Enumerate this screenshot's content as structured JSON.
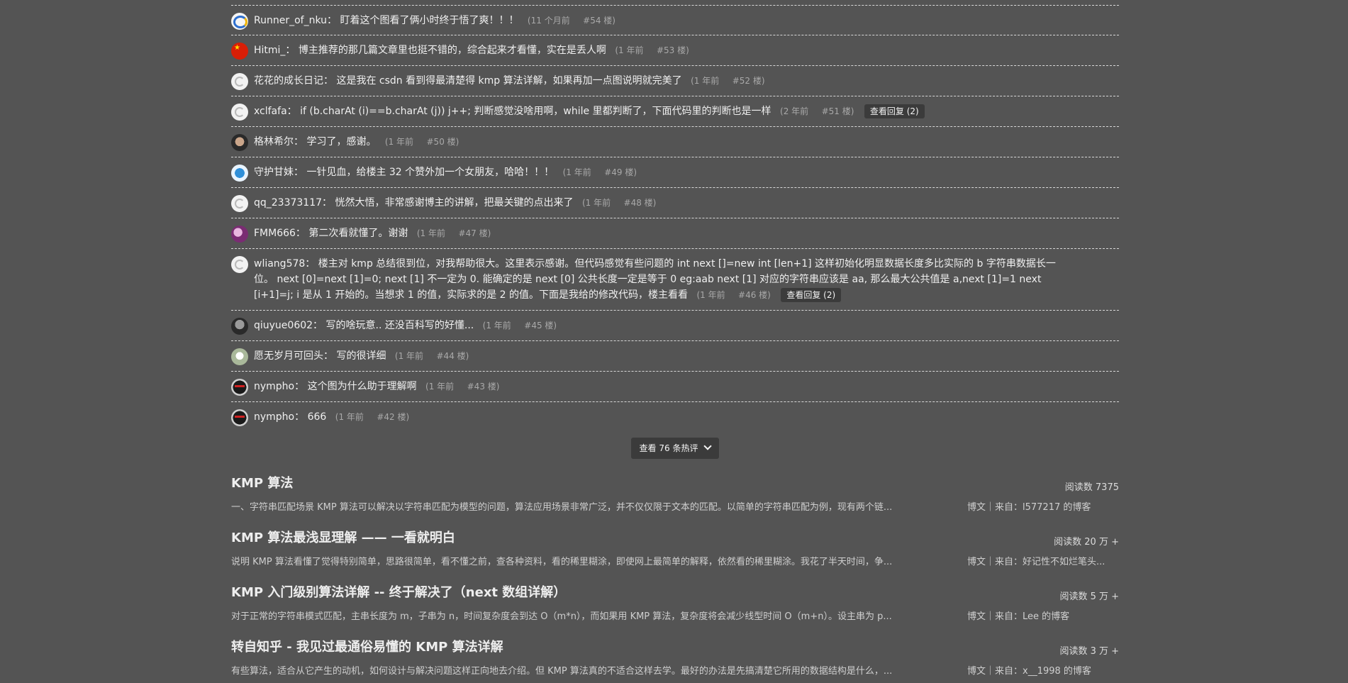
{
  "comments": [
    {
      "user": "Runner_of_nku：",
      "text": "盯着这个图看了俩小时终于悟了爽！！！",
      "time": "(11 个月前",
      "floor": "#54 楼)",
      "avatar": "kfc-icon",
      "reply": ""
    },
    {
      "user": "Hitmi_：",
      "text": "博主推荐的那几篇文章里也挺不错的，综合起来才看懂，实在是丢人啊",
      "time": "(1 年前",
      "floor": "#53 楼)",
      "avatar": "flag-icon",
      "reply": ""
    },
    {
      "user": "花花的成长日记：",
      "text": "这是我在 csdn 看到得最清楚得 kmp 算法详解，如果再加一点图说明就完美了",
      "time": "(1 年前",
      "floor": "#52 楼)",
      "avatar": "csdn-icon",
      "reply": ""
    },
    {
      "user": "xclfafa：",
      "text": "if (b.charAt (i)==b.charAt (j)) j++; 判断感觉没啥用啊，while 里都判断了，下面代码里的判断也是一样",
      "time": "(2 年前",
      "floor": "#51 楼)",
      "avatar": "csdn-icon",
      "reply": "查看回复 (2)"
    },
    {
      "user": "格林希尔：",
      "text": "学习了，感谢。",
      "time": "(1 年前",
      "floor": "#50 楼)",
      "avatar": "dark-icon",
      "reply": ""
    },
    {
      "user": "守护甘妹：",
      "text": "一针见血，给楼主 32 个赞外加一个女朋友，哈哈！！！",
      "time": "(1 年前",
      "floor": "#49 楼)",
      "avatar": "blue-icon",
      "reply": ""
    },
    {
      "user": "qq_23373117：",
      "text": "恍然大悟，非常感谢博主的讲解，把最关键的点出来了",
      "time": "(1 年前",
      "floor": "#48 楼)",
      "avatar": "csdn-icon",
      "reply": ""
    },
    {
      "user": "FMM666：",
      "text": "第二次看就懂了。谢谢",
      "time": "(1 年前",
      "floor": "#47 楼)",
      "avatar": "pink-icon",
      "reply": ""
    },
    {
      "user": "wliang578：",
      "text": "楼主对 kmp 总结很到位，对我帮助很大。这里表示感谢。但代码感觉有些问题的 int next []=new int [len+1] 这样初始化明显数据长度多比实际的 b 字符串数据长一位。 next [0]=next [1]=0; next [1] 不一定为 0. 能确定的是 next [0] 公共长度一定是等于 0 eg:aab next [1] 对应的字符串应该是 aa, 那么最大公共值是 a,next [1]=1 next [i+1]=j; i 是从 1 开始的。当想求 1 的值，实际求的是 2 的值。下面是我给的修改代码，楼主看看",
      "time": "(1 年前",
      "floor": "#46 楼)",
      "avatar": "csdn-icon",
      "reply": "查看回复 (2)"
    },
    {
      "user": "qiuyue0602：",
      "text": "写的啥玩意.. 还没百科写的好懂...",
      "time": "(1 年前",
      "floor": "#45 楼)",
      "avatar": "grey-icon",
      "reply": ""
    },
    {
      "user": "愿无岁月可回头：",
      "text": "写的很详细",
      "time": "(1 年前",
      "floor": "#44 楼)",
      "avatar": "light-icon",
      "reply": ""
    },
    {
      "user": "nympho：",
      "text": "这个图为什么助于理解啊",
      "time": "(1 年前",
      "floor": "#43 楼)",
      "avatar": "mask-icon",
      "reply": ""
    },
    {
      "user": "nympho：",
      "text": "666",
      "time": "(1 年前",
      "floor": "#42 楼)",
      "avatar": "mask-icon",
      "reply": ""
    }
  ],
  "more_button": {
    "label": "查看 76 条热评"
  },
  "related": [
    {
      "title": "KMP 算法",
      "reads": "阅读数 7375",
      "desc": "一、字符串匹配场景 KMP 算法可以解决以字符串匹配为模型的问题，算法应用场景非常广泛，并不仅仅限于文本的匹配。以简单的字符串匹配为例，现有两个链...",
      "source": "博文｜来自：l577217 的博客"
    },
    {
      "title": "KMP 算法最浅显理解 —— 一看就明白",
      "reads": "阅读数 20 万 +",
      "desc": "说明 KMP 算法看懂了觉得特别简单，思路很简单，看不懂之前，查各种资料，看的稀里糊涂，即使网上最简单的解释，依然看的稀里糊涂。我花了半天时间，争...",
      "source": "博文｜来自：好记性不如烂笔头..."
    },
    {
      "title": "KMP 入门级别算法详解 -- 终于解决了（next 数组详解）",
      "reads": "阅读数 5 万 +",
      "desc": "对于正常的字符串模式匹配，主串长度为 m，子串为 n，时间复杂度会到达 O（m*n），而如果用 KMP 算法，复杂度将会减少线型时间 O（m+n）。设主串为 p...",
      "source": "博文｜来自：Lee 的博客"
    },
    {
      "title": "转自知乎 - 我见过最通俗易懂的 KMP 算法详解",
      "reads": "阅读数 3 万 +",
      "desc": "有些算法，适合从它产生的动机，如何设计与解决问题这样正向地去介绍。但 KMP 算法真的不适合这样去学。最好的办法是先搞清楚它所用的数据结构是什么，...",
      "source": "博文｜来自：x__1998 的博客"
    }
  ]
}
